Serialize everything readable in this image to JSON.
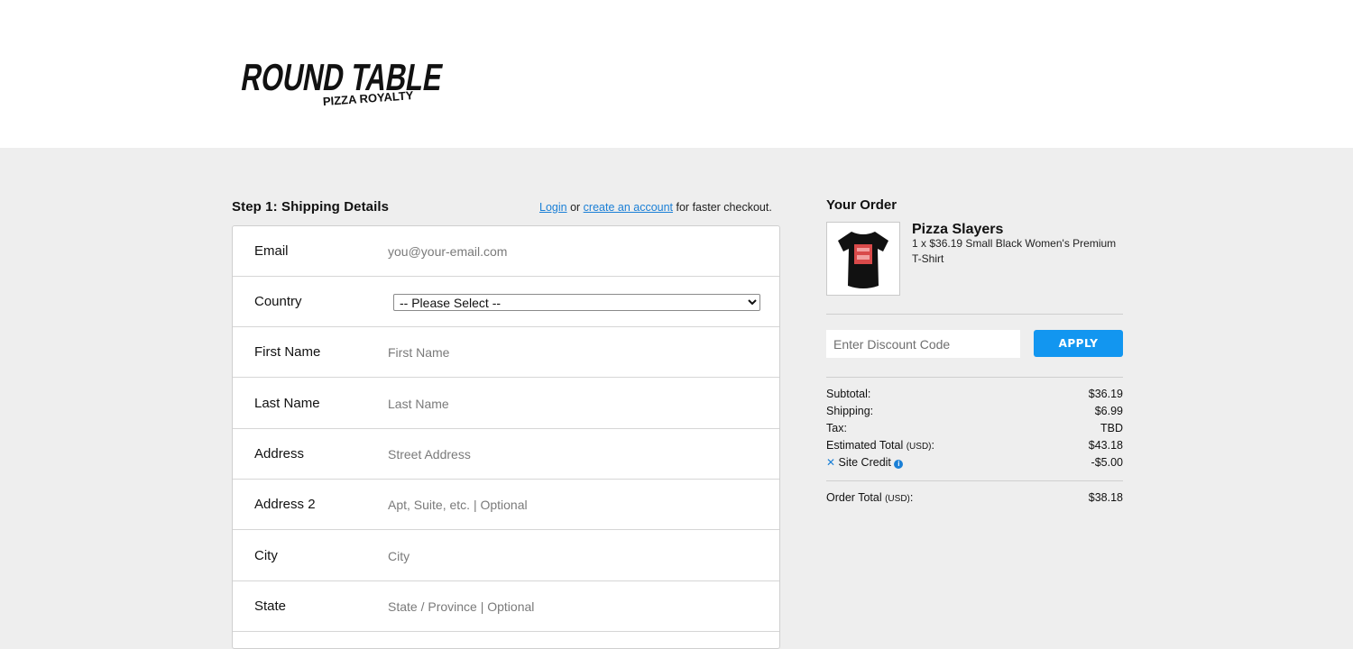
{
  "brand": {
    "logo_main": "ROUND TABLE",
    "logo_sub": "PIZZA ROYALTY"
  },
  "checkout": {
    "step_title": "Step 1: Shipping Details",
    "login_link": "Login",
    "or_text": " or ",
    "create_account_link": "create an account",
    "faster_text": " for faster checkout.",
    "fields": [
      {
        "label": "Email",
        "placeholder": "you@your-email.com",
        "value": ""
      },
      {
        "label": "Country",
        "selected": "-- Please Select --"
      },
      {
        "label": "First Name",
        "placeholder": "First Name",
        "value": ""
      },
      {
        "label": "Last Name",
        "placeholder": "Last Name",
        "value": ""
      },
      {
        "label": "Address",
        "placeholder": "Street Address",
        "value": ""
      },
      {
        "label": "Address 2",
        "placeholder": "Apt, Suite, etc. | Optional",
        "value": ""
      },
      {
        "label": "City",
        "placeholder": "City",
        "value": ""
      },
      {
        "label": "State",
        "placeholder": "State / Province | Optional",
        "value": ""
      }
    ]
  },
  "order": {
    "title": "Your Order",
    "item": {
      "name": "Pizza Slayers",
      "description": "1 x $36.19 Small Black Women's Premium T-Shirt",
      "thumb_icon": "black-tshirt-icon"
    },
    "discount": {
      "placeholder": "Enter Discount Code",
      "button_label": "APPLY"
    },
    "totals": [
      {
        "label": "Subtotal:",
        "value": "$36.19"
      },
      {
        "label": "Shipping:",
        "value": "$6.99"
      },
      {
        "label": "Tax:",
        "value": "TBD"
      },
      {
        "label": "Estimated Total",
        "unit": "(USD)",
        "suffix": ":",
        "value": "$43.18"
      },
      {
        "label": "Site Credit",
        "value": "-$5.00"
      }
    ],
    "order_total": {
      "label": "Order Total",
      "unit": "(USD)",
      "suffix": ":",
      "value": "$38.18"
    }
  },
  "colors": {
    "accent": "#1296f0",
    "link": "#1a7fd6",
    "page_bg": "#eeeeee"
  }
}
